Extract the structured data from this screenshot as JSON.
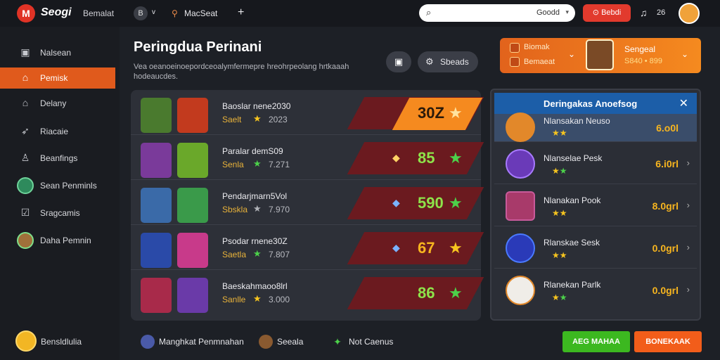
{
  "header": {
    "logo_icon": "M",
    "brand": "Seogi",
    "brand_sub": "Bemalat",
    "icon_1": "B",
    "chevron": "v",
    "location_icon": "pin-icon",
    "location_label": "MacSeat",
    "add_label": "+",
    "search": {
      "value": "Goodd",
      "icon": "search-icon"
    },
    "action_button": "Bebdi",
    "badge_text": "26"
  },
  "sidebar": {
    "items": [
      {
        "label": "Nalsean",
        "icon": "document-icon"
      },
      {
        "label": "Pemisk",
        "icon": "home-icon",
        "active": true
      },
      {
        "label": "Delany",
        "icon": "house-icon"
      },
      {
        "label": "Riacaie",
        "icon": "rocket-icon"
      },
      {
        "label": "Beanfings",
        "icon": "person-icon"
      },
      {
        "label": "Sean Penminls",
        "icon": "avatar"
      },
      {
        "label": "Sragcamis",
        "icon": "check-icon"
      },
      {
        "label": "Daha Pemnin",
        "icon": "avatar"
      }
    ],
    "footer_user": "Bensldlulia"
  },
  "main": {
    "title": "Peringdua Perinani",
    "description": "Vea oeanoeinoepordceoalymfermepre hreohrpeolang hrtkaaah hodeaucdes.",
    "icon_btn": "▣",
    "pill_btn": "Sbeads"
  },
  "promo": {
    "line1": "Biomak",
    "line2": "Bemaeat",
    "title": "Sengeal",
    "subtitle": "S840 • 899"
  },
  "games": [
    {
      "name": "Baoslar nene2030",
      "sub": "Saelt",
      "stars": "2023",
      "score": "30Z",
      "highlight": true
    },
    {
      "name": "Paralar demS09",
      "sub": "Senla",
      "stars": "7.271",
      "score": "85"
    },
    {
      "name": "Pendarjmarn5Vol",
      "sub": "Sbskla",
      "stars": "7.970",
      "score": "590"
    },
    {
      "name": "Psodar rnene30Z",
      "sub": "Saetla",
      "stars": "7.807",
      "score": "67"
    },
    {
      "name": "Baeskahmaoo8lrl",
      "sub": "Sanlle",
      "stars": "3.000",
      "score": "86"
    }
  ],
  "leaderboard": {
    "title": "Deringakas Anoefsog",
    "close": "✕",
    "rows": [
      {
        "name": "Nlansakan Neuso",
        "score": "6.o0l"
      },
      {
        "name": "Nlanselae Pesk",
        "score": "6.i0rl"
      },
      {
        "name": "Nlanakan Pook",
        "score": "8.0grl"
      },
      {
        "name": "Rlanskae Sesk",
        "score": "0.0grl"
      },
      {
        "name": "Rlanekan Parlk",
        "score": "0.0grl"
      }
    ]
  },
  "bottom": {
    "item1": "Manghkat Penmnahan",
    "item2": "Seeala",
    "item3": "Not Caenus",
    "btn_green": "AEG MAHAA",
    "btn_orange": "BONEKAAK"
  },
  "colors": {
    "accent_orange": "#e05a1c",
    "score_green": "#8ee34a",
    "header_blue": "#1c5ea8"
  }
}
